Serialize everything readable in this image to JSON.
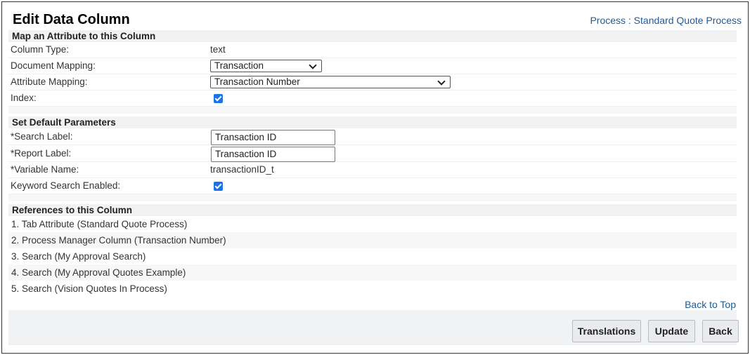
{
  "page": {
    "title": "Edit Data Column",
    "breadcrumb": "Process : Standard Quote Process",
    "back_to_top": "Back to Top"
  },
  "map_section": {
    "heading": "Map an Attribute to this Column",
    "column_type_label": "Column Type:",
    "column_type_value": "text",
    "document_mapping_label": "Document Mapping:",
    "document_mapping_value": "Transaction",
    "attribute_mapping_label": "Attribute Mapping:",
    "attribute_mapping_value": "Transaction Number",
    "index_label": "Index:",
    "index_checked": true
  },
  "defaults_section": {
    "heading": "Set Default Parameters",
    "search_label_label": "*Search Label:",
    "search_label_value": "Transaction ID",
    "report_label_label": "*Report Label:",
    "report_label_value": "Transaction ID",
    "variable_name_label": "*Variable Name:",
    "variable_name_value": "transactionID_t",
    "keyword_search_label": "Keyword Search Enabled:",
    "keyword_search_checked": true
  },
  "references_section": {
    "heading": "References to this Column",
    "items": [
      "1.  Tab Attribute (Standard Quote Process)",
      "2.  Process Manager Column (Transaction Number)",
      "3.  Search (My Approval Search)",
      "4.  Search (My Approval Quotes Example)",
      "5.  Search (Vision Quotes In Process)"
    ]
  },
  "footer": {
    "translations_label": "Translations",
    "update_label": "Update",
    "back_label": "Back"
  }
}
